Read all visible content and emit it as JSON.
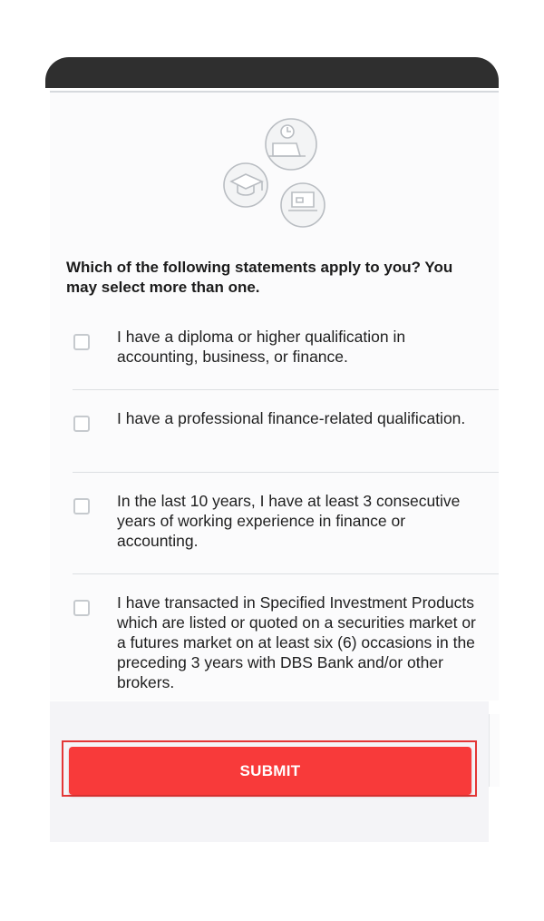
{
  "form": {
    "question": "Which of the following statements apply to you? You may select more than one.",
    "options": [
      {
        "label": "I have a diploma or higher qualification in accounting, business, or finance.",
        "checked": false
      },
      {
        "label": "I have a professional finance-related qualification.",
        "checked": false
      },
      {
        "label": "In the last 10 years, I have at least 3 consecutive years of working experience in finance or accounting.",
        "checked": false
      },
      {
        "label": "I have transacted in Specified Investment Products which are listed or quoted on a securities market or a futures market on at least six (6) occasions in the preceding 3 years with DBS Bank and/or other brokers.",
        "checked": false
      }
    ]
  },
  "footer": {
    "submit_label": "SUBMIT"
  },
  "colors": {
    "accent": "#f83a3a",
    "highlight": "#e33636",
    "top_bar": "#2f2f2f"
  },
  "icons": [
    "education-icon",
    "clock-laptop-icon",
    "laptop-icon"
  ]
}
